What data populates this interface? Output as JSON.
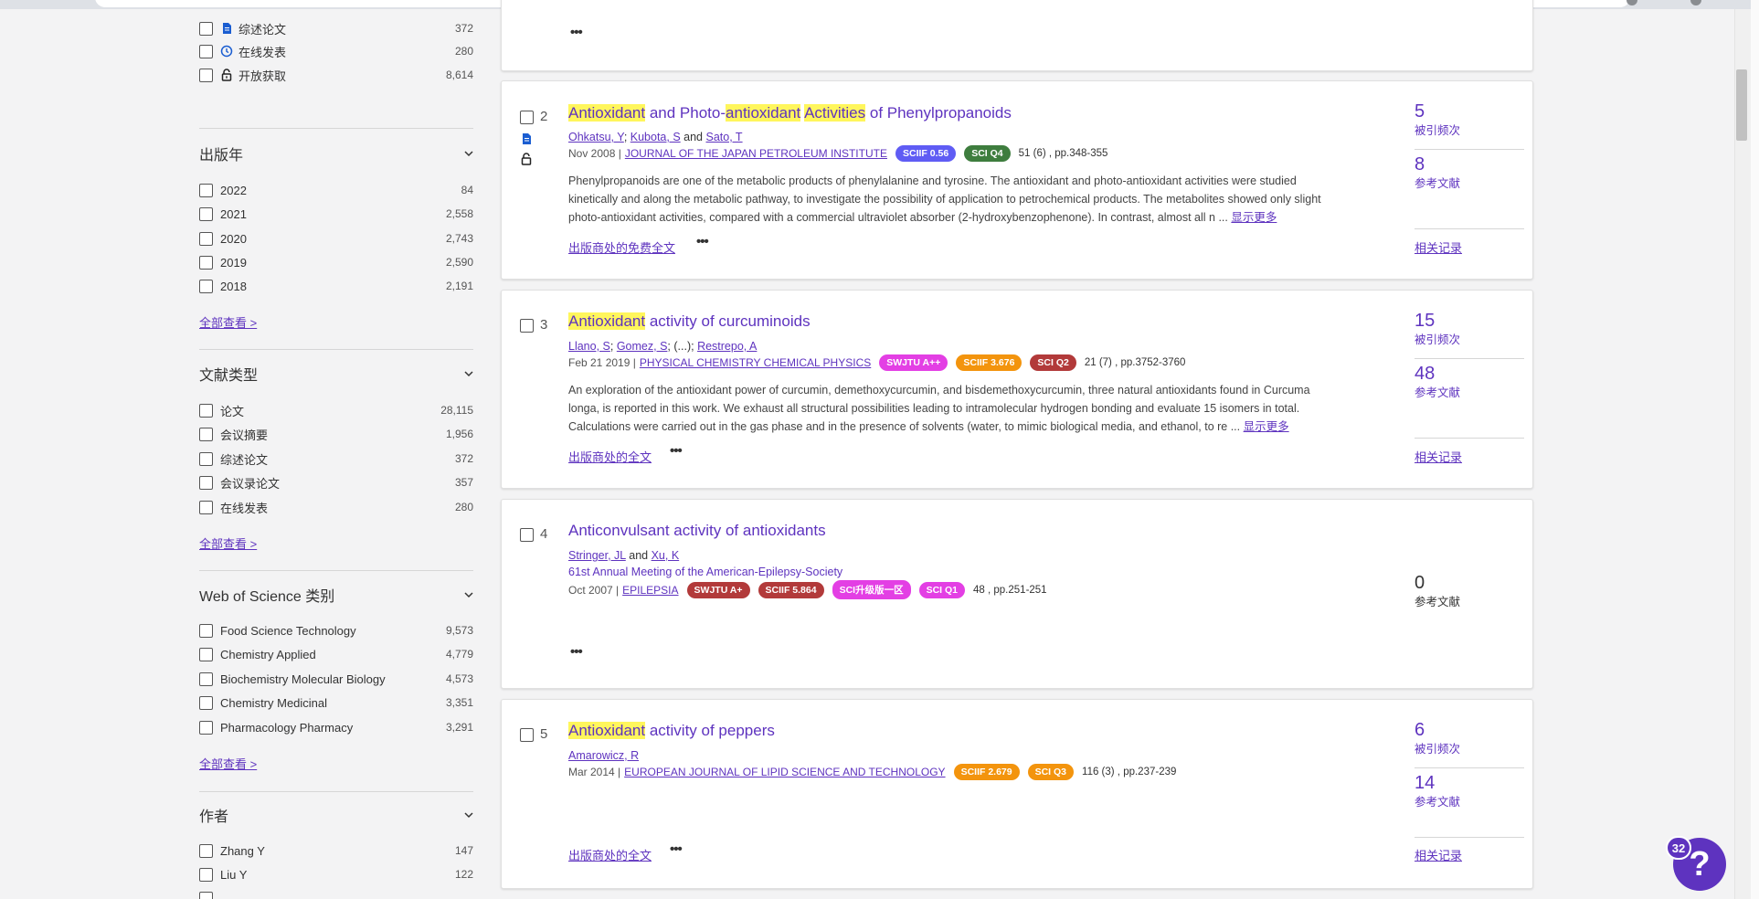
{
  "colors": {
    "accent": "#5e33bf",
    "highlight": "#fff65c",
    "badge_blue": "#5f5cf4",
    "badge_green": "#3e7d3e",
    "badge_magenta": "#e33fe4",
    "badge_orange": "#f3940d",
    "badge_red": "#b23a3a"
  },
  "sidebar": {
    "top_items": [
      {
        "label": "综述论文",
        "count": "372",
        "icon": "document-icon"
      },
      {
        "label": "在线发表",
        "count": "280",
        "icon": "clock-icon"
      },
      {
        "label": "开放获取",
        "count": "8,614",
        "icon": "lock-open-icon"
      }
    ],
    "year": {
      "title": "出版年",
      "items": [
        {
          "label": "2022",
          "count": "84"
        },
        {
          "label": "2021",
          "count": "2,558"
        },
        {
          "label": "2020",
          "count": "2,743"
        },
        {
          "label": "2019",
          "count": "2,590"
        },
        {
          "label": "2018",
          "count": "2,191"
        }
      ],
      "see_all": "全部查看 >"
    },
    "doc_type": {
      "title": "文献类型",
      "items": [
        {
          "label": "论文",
          "count": "28,115"
        },
        {
          "label": "会议摘要",
          "count": "1,956"
        },
        {
          "label": "综述论文",
          "count": "372"
        },
        {
          "label": "会议录论文",
          "count": "357"
        },
        {
          "label": "在线发表",
          "count": "280"
        }
      ],
      "see_all": "全部查看 >"
    },
    "wos": {
      "title": "Web of Science 类别",
      "items": [
        {
          "label": "Food Science Technology",
          "count": "9,573"
        },
        {
          "label": "Chemistry Applied",
          "count": "4,779"
        },
        {
          "label": "Biochemistry Molecular Biology",
          "count": "4,573"
        },
        {
          "label": "Chemistry Medicinal",
          "count": "3,351"
        },
        {
          "label": "Pharmacology Pharmacy",
          "count": "3,291"
        }
      ],
      "see_all": "全部查看 >"
    },
    "authors": {
      "title": "作者",
      "items": [
        {
          "label": "Zhang Y",
          "count": "147"
        },
        {
          "label": "Liu Y",
          "count": "122"
        }
      ]
    }
  },
  "records": [
    {
      "num": "2",
      "title_parts": [
        "Antioxidant",
        " and Photo-",
        "antioxidant",
        " ",
        "Activities",
        " of Phenylpropanoids"
      ],
      "authors": [
        "Ohkatsu, Y",
        "Kubota, S",
        "Sato, T"
      ],
      "and": "and",
      "date": "Nov 2008 |",
      "journal": "JOURNAL OF THE JAPAN PETROLEUM INSTITUTE",
      "badges": [
        "SCIIF 0.56",
        "SCI Q4"
      ],
      "pages": "51 (6) , pp.348-355",
      "abstract": [
        "Phenylpropanoids are one of the metabolic products of phenylalanine and tyrosine. The antioxidant and photo-antioxidant activities were studied",
        "kinetically and along the metabolic pathway, to investigate the possibility of application to petrochemical products. The metabolites showed only slight",
        "photo-antioxidant activities, compared with a commercial ultraviolet absorber (2-hydroxybenzophenone). In contrast, almost all n ..."
      ],
      "show_more": "显示更多",
      "link": "出版商处的免费全文",
      "citations": "5",
      "citations_label": "被引频次",
      "refs": "8",
      "refs_label": "参考文献",
      "related": "相关记录"
    },
    {
      "num": "3",
      "title_parts": [
        "Antioxidant",
        " activity of curcuminoids"
      ],
      "authors": [
        "Llano, S",
        "Gomez, S",
        "Restrepo, A"
      ],
      "ellipsis": "(...);",
      "date": "Feb 21 2019 |",
      "journal": "PHYSICAL CHEMISTRY CHEMICAL PHYSICS",
      "badges": [
        "SWJTU A++",
        "SCIIF 3.676",
        "SCI Q2"
      ],
      "pages": "21 (7) , pp.3752-3760",
      "abstract": [
        "An exploration of the antioxidant power of curcumin, demethoxycurcumin, and bisdemethoxycurcumin, three natural antioxidants found in Curcuma",
        "longa, is reported in this work. We exhaust all structural possibilities leading to intramolecular hydrogen bonding and evaluate 15 isomers in total.",
        "Calculations were carried out in the gas phase and in the presence of solvents (water, to mimic biological media, and ethanol, to re ..."
      ],
      "show_more": "显示更多",
      "link": "出版商处的全文",
      "citations": "15",
      "citations_label": "被引频次",
      "refs": "48",
      "refs_label": "参考文献",
      "related": "相关记录"
    },
    {
      "num": "4",
      "title": "Anticonvulsant activity of antioxidants",
      "authors": [
        "Stringer, JL",
        "Xu, K"
      ],
      "and": "and",
      "conference": "61st Annual Meeting of the American-Epilepsy-Society",
      "date": "Oct 2007 |",
      "journal": "EPILEPSIA",
      "badges": [
        "SWJTU A+",
        "SCIIF 5.864",
        "SCI升级版一区",
        "SCI Q1"
      ],
      "pages": "48 , pp.251-251",
      "refs": "0",
      "refs_label": "参考文献"
    },
    {
      "num": "5",
      "title_parts": [
        "Antioxidant",
        " activity of peppers"
      ],
      "authors": [
        "Amarowicz, R"
      ],
      "date": "Mar 2014 |",
      "journal": "EUROPEAN JOURNAL OF LIPID SCIENCE AND TECHNOLOGY",
      "badges": [
        "SCIIF 2.679",
        "SCI Q3"
      ],
      "pages": "116 (3) , pp.237-239",
      "link": "出版商处的全文",
      "citations": "6",
      "citations_label": "被引频次",
      "refs": "14",
      "refs_label": "参考文献",
      "related": "相关记录"
    }
  ],
  "more_dots": "•••",
  "help": {
    "badge": "32",
    "icon": "?"
  }
}
